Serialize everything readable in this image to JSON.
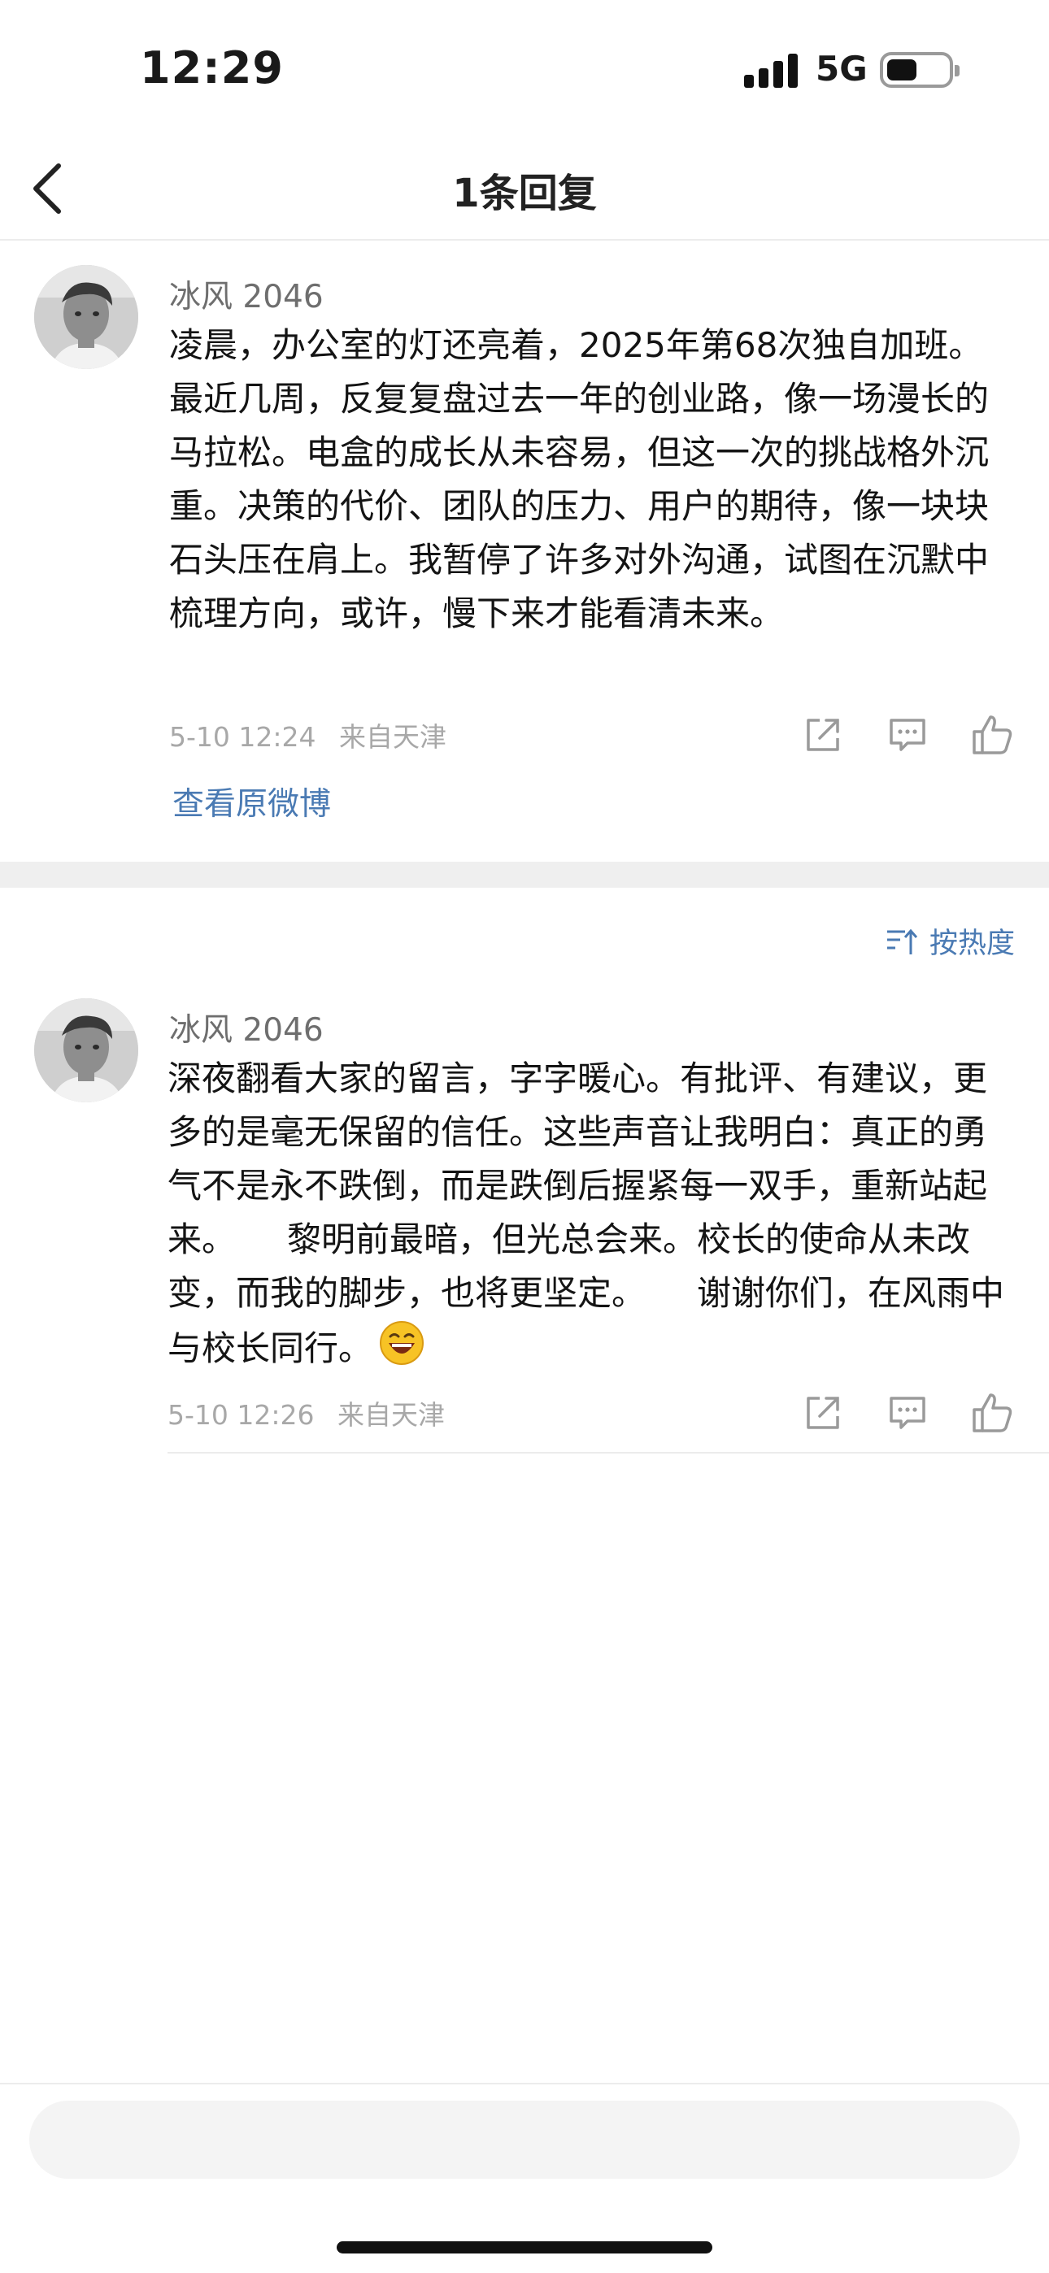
{
  "status_bar": {
    "time": "12:29",
    "network": "5G"
  },
  "nav": {
    "title": "1条回复"
  },
  "original_post": {
    "username": "冰风 2046",
    "text": "凌晨，办公室的灯还亮着，2025年第68次独自加班。 最近几周，反复复盘过去一年的创业路，像一场漫长的马拉松。电盒的成长从未容易，但这一次的挑战格外沉重。决策的代价、团队的压力、用户的期待，像一块块石头压在肩上。我暂停了许多对外沟通，试图在沉默中梳理方向，或许，慢下来才能看清未来。",
    "date": "5-10 12:24",
    "location": "来自天津",
    "view_original": "查看原微博"
  },
  "sort": {
    "label": "按热度"
  },
  "reply": {
    "username": "冰风 2046",
    "text": "深夜翻看大家的留言，字字暖心。有批评、有建议，更多的是毫无保留的信任。这些声音让我明白：真正的勇气不是永不跌倒，而是跌倒后握紧每一双手，重新站起来。　　黎明前最暗，但光总会来。校长的使命从未改变，而我的脚步，也将更坚定。　　谢谢你们，在风雨中与校长同行。",
    "emoji": "grinning-face-emoji",
    "date": "5-10 12:26",
    "location": "来自天津"
  },
  "icons": {
    "back": "chevron-left-icon",
    "forward": "share-icon",
    "comment": "comment-icon",
    "like": "thumbs-up-icon"
  },
  "colors": {
    "link": "#4a7ab3",
    "meta": "#a8a8a8",
    "band": "#efefef"
  }
}
